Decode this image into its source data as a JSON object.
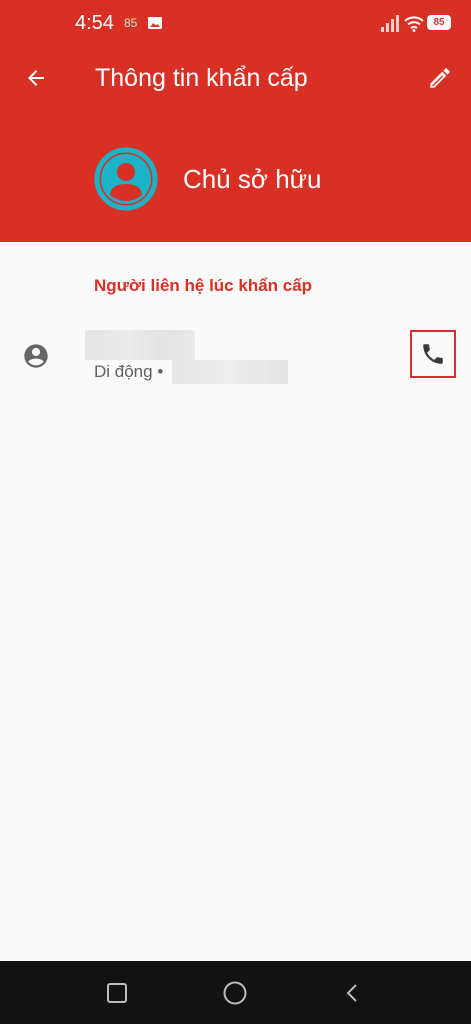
{
  "status_bar": {
    "time": "4:54",
    "notification_badge": "85",
    "battery_level": "85",
    "icons": [
      "image-icon",
      "signal-icon",
      "wifi-icon",
      "battery-icon"
    ]
  },
  "header": {
    "title": "Thông tin khẩn cấp",
    "owner_name": "Chủ sở hữu",
    "back_icon": "arrow-back-icon",
    "edit_icon": "pencil-icon",
    "avatar_icon": "account-circle-icon"
  },
  "section": {
    "title": "Người liên hệ lúc khẩn cấp"
  },
  "contact": {
    "phone_type": "Di động •",
    "avatar_icon": "account-circle-outline-icon",
    "call_icon": "phone-icon"
  },
  "nav_bar": {
    "icons": [
      "square-recents-icon",
      "circle-home-icon",
      "chevron-back-icon"
    ]
  },
  "colors": {
    "primary": "#d93025",
    "avatar_ring": "#1ab3c8",
    "highlight_border": "#d32f2f",
    "background": "#fafafa",
    "nav_background": "#121212"
  }
}
